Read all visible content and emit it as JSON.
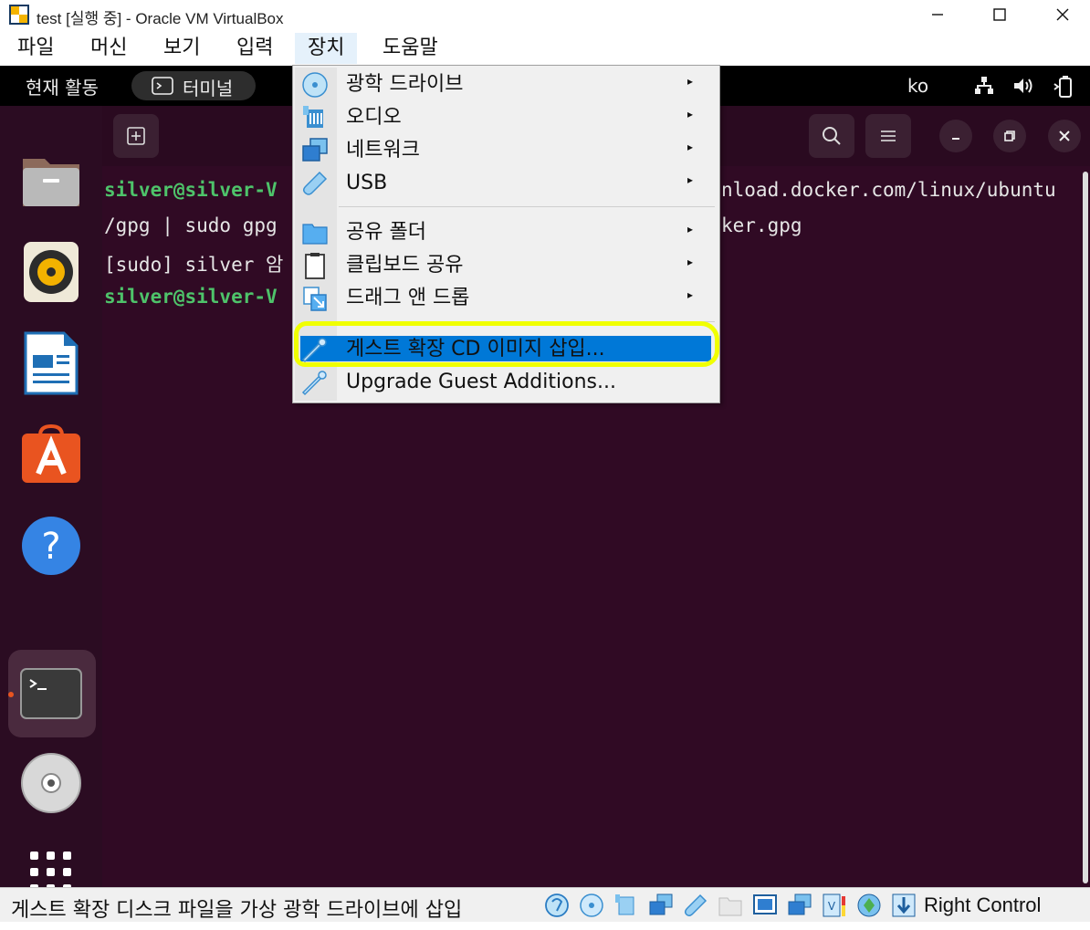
{
  "window": {
    "title": "test [실행 중] - Oracle VM VirtualBox"
  },
  "menubar": {
    "items": [
      "파일",
      "머신",
      "보기",
      "입력",
      "장치",
      "도움말"
    ],
    "active": "장치"
  },
  "gnome": {
    "activities": "현재 활동",
    "app_name": "터미널",
    "lang": "ko"
  },
  "terminal": {
    "title_suffix": "~",
    "lines": [
      {
        "prompt": "silver@silver-V",
        "text_right": "nload.docker.com/linux/ubuntu"
      },
      {
        "text": "/gpg | sudo gpg",
        "text_right": "ker.gpg"
      },
      {
        "text": "[sudo] silver 암"
      },
      {
        "prompt": "silver@silver-V"
      }
    ]
  },
  "dropdown": {
    "items": [
      {
        "label": "광학 드라이브",
        "icon": "optical-disc-icon",
        "submenu": true
      },
      {
        "label": "오디오",
        "icon": "audio-icon",
        "submenu": true
      },
      {
        "label": "네트워크",
        "icon": "network-icon",
        "submenu": true
      },
      {
        "label": "USB",
        "icon": "usb-icon",
        "submenu": true
      },
      {
        "label": "공유 폴더",
        "icon": "shared-folder-icon",
        "submenu": true
      },
      {
        "label": "클립보드 공유",
        "icon": "clipboard-icon",
        "submenu": true
      },
      {
        "label": "드래그 앤 드롭",
        "icon": "drag-drop-icon",
        "submenu": true
      },
      {
        "label": "게스트 확장 CD 이미지 삽입...",
        "icon": "guest-additions-icon",
        "submenu": false,
        "highlighted": true
      },
      {
        "label": "Upgrade Guest Additions...",
        "icon": "guest-additions-icon",
        "submenu": false
      }
    ],
    "arrow": "▸",
    "highlight_color": "#0078d7",
    "marker_color": "#f0ff00"
  },
  "statusbar": {
    "text": "게스트 확장 디스크 파일을 가상 광학 드라이브에 삽입",
    "host_key": "Right Control"
  },
  "colors": {
    "vm_background": "#300a24",
    "prompt_green": "#4ec36a",
    "ubuntu_orange": "#e95420"
  }
}
